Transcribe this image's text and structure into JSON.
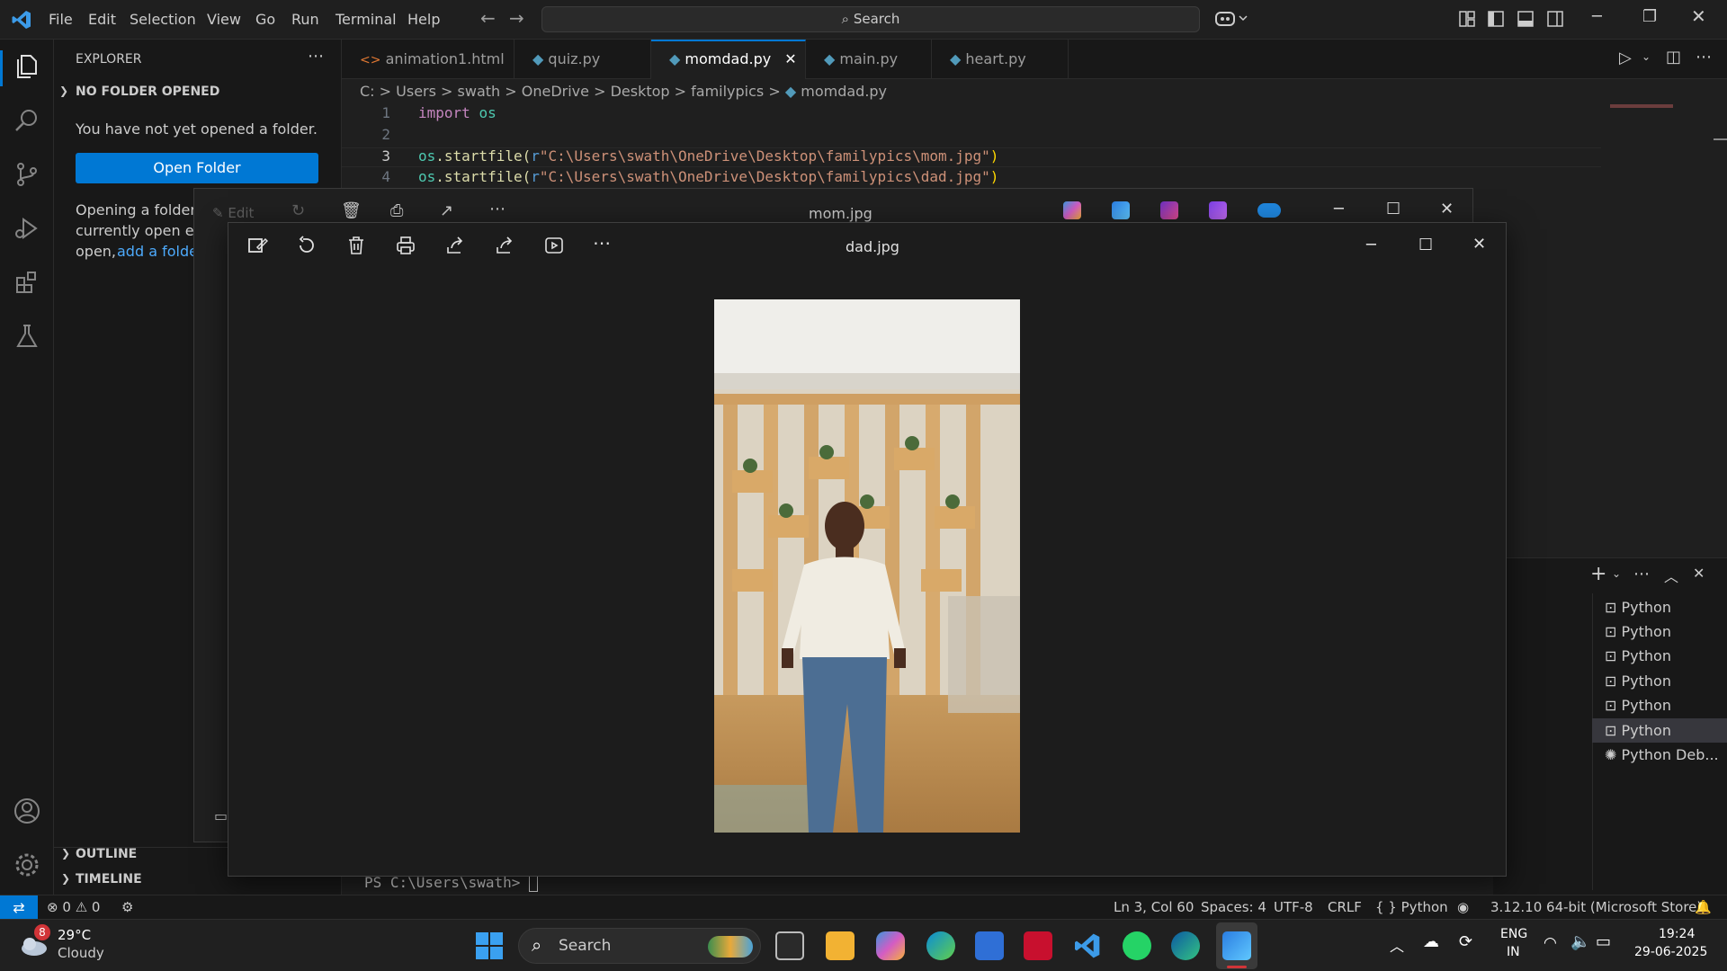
{
  "menu": [
    "File",
    "Edit",
    "Selection",
    "View",
    "Go",
    "Run",
    "Terminal",
    "Help"
  ],
  "search": {
    "label": "Search"
  },
  "sidebar": {
    "title": "EXPLORER",
    "section": "NO FOLDER OPENED",
    "message": "You have not yet opened a folder.",
    "open_folder": "Open Folder",
    "hint_line1": "Opening a folder w",
    "hint_line2": "currently open edi",
    "hint_line3": "open,",
    "hint_link": "add a folder",
    "outline": "OUTLINE",
    "timeline": "TIMELINE"
  },
  "tabs": [
    {
      "label": "animation1.html"
    },
    {
      "label": "quiz.py"
    },
    {
      "label": "momdad.py"
    },
    {
      "label": "main.py"
    },
    {
      "label": "heart.py"
    }
  ],
  "breadcrumb": [
    "C:",
    "Users",
    "swath",
    "OneDrive",
    "Desktop",
    "familypics",
    "momdad.py"
  ],
  "code": {
    "line_numbers": [
      "1",
      "2",
      "3",
      "4"
    ],
    "line1_kw": "import",
    "line1_mod": "os",
    "line3_obj": "os",
    "line3_fn": ".startfile(",
    "line3_prefix": "r",
    "line3_str": "\"C:\\Users\\swath\\OneDrive\\Desktop\\familypics\\mom.jpg\"",
    "line3_close": ")",
    "line4_obj": "os",
    "line4_fn": ".startfile(",
    "line4_prefix": "r",
    "line4_str": "\"C:\\Users\\swath\\OneDrive\\Desktop\\familypics\\dad.jpg\"",
    "line4_close": ")"
  },
  "terminal": {
    "prompt": "PS C:\\Users\\swath> ",
    "sessions": [
      "Python",
      "Python",
      "Python",
      "Python",
      "Python",
      "Python",
      "Python Deb..."
    ]
  },
  "mom_window": {
    "title": "mom.jpg",
    "edit_label": "Edit"
  },
  "dad_window": {
    "title": "dad.jpg"
  },
  "statusbar": {
    "errors": "0",
    "warnings": "0",
    "position": "Ln 3, Col 60",
    "spaces": "Spaces: 4",
    "encoding": "UTF-8",
    "eol": "CRLF",
    "language": "Python",
    "interpreter": "3.12.10 64-bit (Microsoft Store)"
  },
  "taskbar": {
    "weather_temp": "29°C",
    "weather_desc": "Cloudy",
    "weather_badge": "8",
    "search": "Search",
    "lang1": "ENG",
    "lang2": "IN",
    "time": "19:24",
    "date": "29-06-2025"
  },
  "colors": {
    "accent": "#0078d4",
    "keyword": "#c586c0",
    "module": "#4ec9b0",
    "string": "#ce9178",
    "func": "#dcdcaa",
    "variable": "#9cdcfe"
  }
}
